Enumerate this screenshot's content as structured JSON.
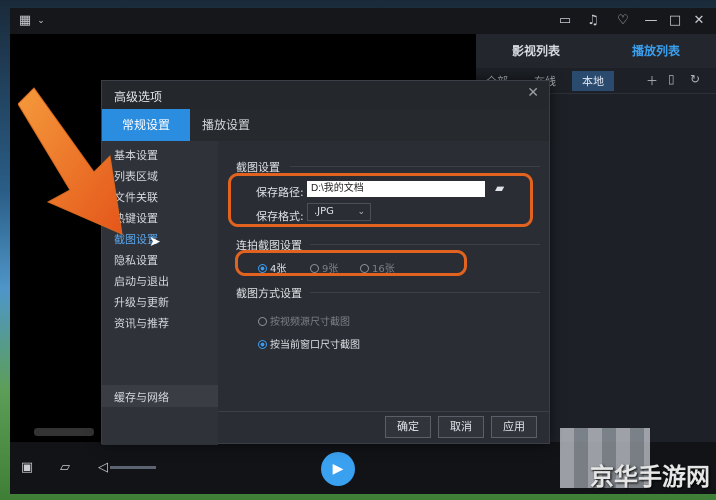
{
  "colors": {
    "accent": "#2b8de0",
    "annotation": "#e2631f"
  },
  "playlist": {
    "tab_video": "影视列表",
    "tab_play": "播放列表",
    "sub": [
      "全部",
      "在线",
      "本地"
    ]
  },
  "dialog": {
    "title": "高级选项",
    "tabs": [
      "常规设置",
      "播放设置"
    ],
    "side_items": [
      "基本设置",
      "列表区域",
      "文件关联",
      "热键设置",
      "截图设置",
      "隐私设置",
      "启动与退出",
      "升级与更新",
      "资讯与推荐"
    ],
    "side_footer": "缓存与网络",
    "screenshot": {
      "section": "截图设置",
      "path_label": "保存路径:",
      "path_value": "D:\\我的文档",
      "format_label": "保存格式:",
      "format_value": ".JPG"
    },
    "burst": {
      "section": "连拍截图设置",
      "options": [
        "4张",
        "9张",
        "16张"
      ]
    },
    "mode": {
      "section": "截图方式设置",
      "options": [
        "按视频源尺寸截图",
        "按当前窗口尺寸截图"
      ]
    },
    "buttons": {
      "ok": "确定",
      "cancel": "取消",
      "apply": "应用"
    }
  },
  "watermark": "京华手游网"
}
